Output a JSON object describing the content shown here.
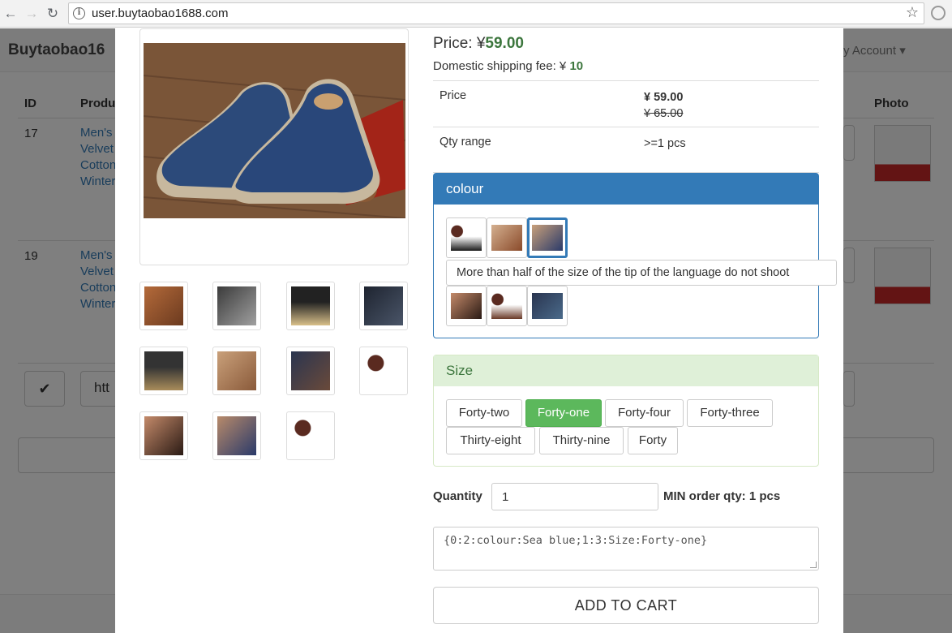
{
  "browser": {
    "url": "user.buytaobao1688.com"
  },
  "background": {
    "brand": "Buytaobao16",
    "account": "y Account ▾",
    "headers": {
      "id": "ID",
      "product": "Produ",
      "photo": "Photo"
    },
    "rows": [
      {
        "id": "17",
        "lines": [
          "Men's",
          "Velvet",
          "Cotton",
          "Winter"
        ]
      },
      {
        "id": "19",
        "lines": [
          "Men's",
          "Velvet",
          "Cotton",
          "Winter"
        ]
      }
    ],
    "input_partial": "htt"
  },
  "product": {
    "price_label": "Price: ¥",
    "price_value": "59.00",
    "shipping_label": "Domestic shipping fee: ¥",
    "shipping_value": "10",
    "table": {
      "price_key": "Price",
      "price_current": "¥ 59.00",
      "price_original": "¥ 65.00",
      "qty_key": "Qty range",
      "qty_value": ">=1 pcs"
    }
  },
  "colour_panel": {
    "title": "colour",
    "tooltip": "More than half of the size of the tip of the language do not shoot",
    "selected": "Sea blue"
  },
  "size_panel": {
    "title": "Size",
    "options": [
      "Forty-two",
      "Forty-one",
      "Forty-four",
      "Forty-three",
      "Thirty-eight",
      "Thirty-nine",
      "Forty"
    ],
    "selected": "Forty-one"
  },
  "order": {
    "quantity_label": "Quantity",
    "quantity_value": "1",
    "min_qty": "MIN order qty: 1 pcs",
    "selection": "{0:2:colour:Sea blue;1:3:Size:Forty-one}",
    "add_to_cart": "ADD TO CART"
  },
  "colors": {
    "primary": "#337ab7",
    "success": "#5cb85c",
    "price_green": "#3c763d",
    "panel_success_bg": "#dff0d8"
  }
}
